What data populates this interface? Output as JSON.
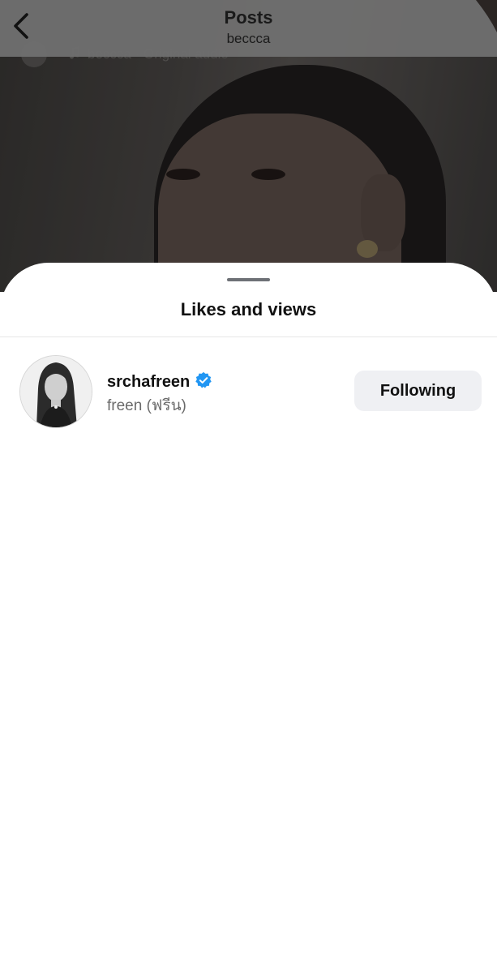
{
  "header": {
    "title": "Posts",
    "subtitle": "beccca"
  },
  "background_post": {
    "audio_text": "beccca · Original audio"
  },
  "sheet": {
    "title": "Likes and views"
  },
  "likes_list": [
    {
      "username": "srchafreen",
      "verified": true,
      "full_name": "freen (ฟรีน)",
      "button_label": "Following"
    }
  ],
  "icons": {
    "back": "chevron-left-icon",
    "verified": "verified-badge-icon",
    "music": "music-note-icon"
  },
  "colors": {
    "verified_blue": "#2196f3",
    "button_bg": "#eff0f3",
    "secondary_text": "#6b6b6b"
  }
}
